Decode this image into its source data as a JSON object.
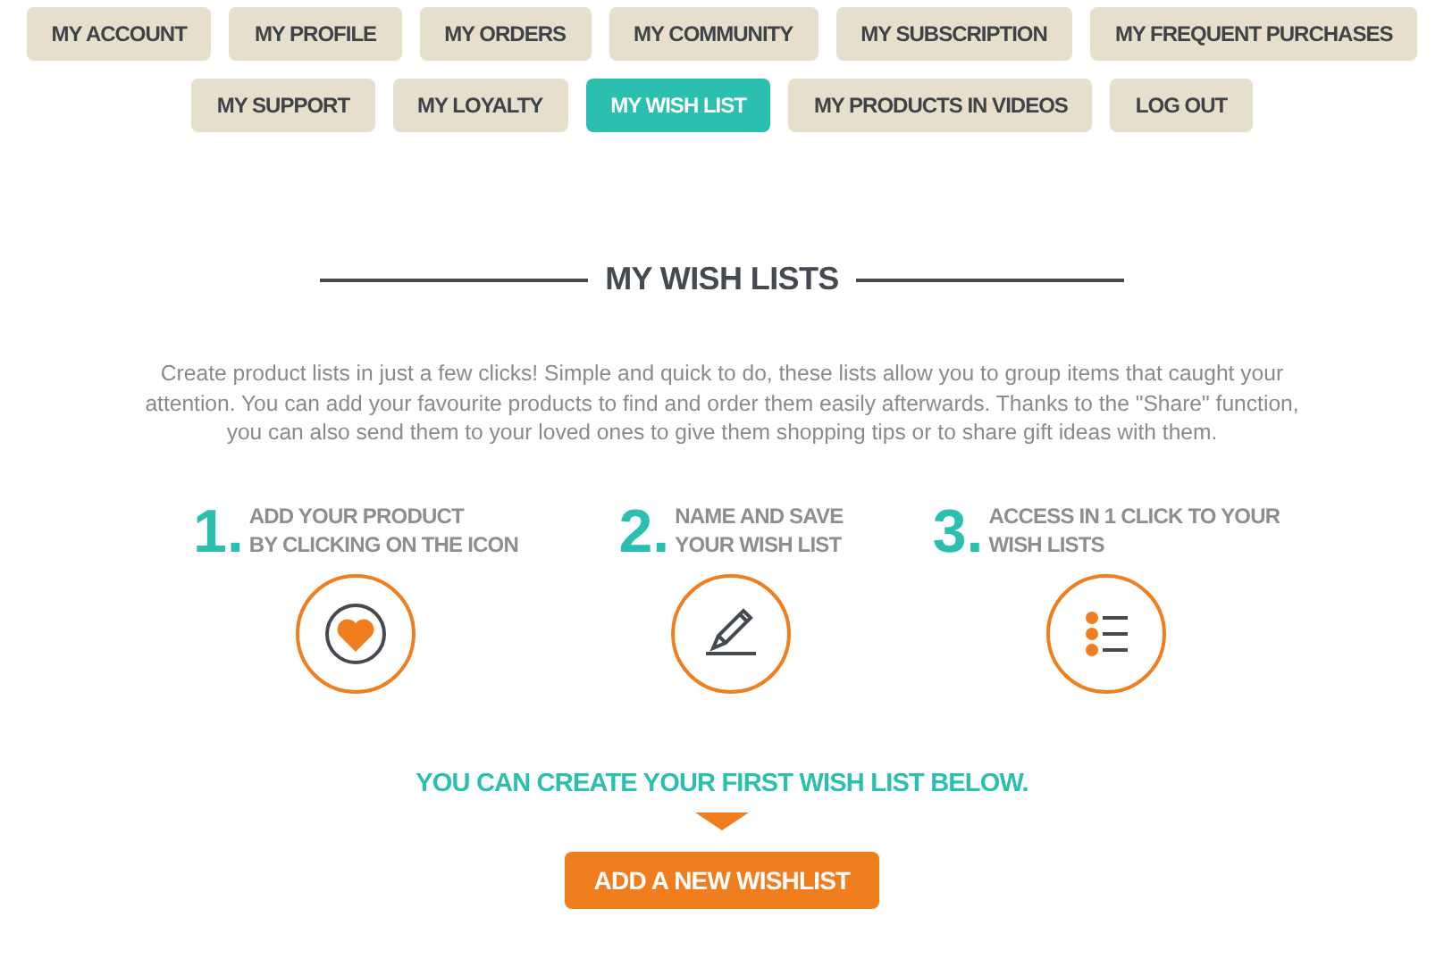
{
  "nav": [
    [
      {
        "label": "MY ACCOUNT",
        "selected": false
      },
      {
        "label": "MY PROFILE",
        "selected": false
      },
      {
        "label": "MY ORDERS",
        "selected": false
      },
      {
        "label": "MY COMMUNITY",
        "selected": false
      },
      {
        "label": "MY SUBSCRIPTION",
        "selected": false
      },
      {
        "label": "MY FREQUENT PURCHASES",
        "selected": false
      }
    ],
    [
      {
        "label": "MY SUPPORT",
        "selected": false
      },
      {
        "label": "MY LOYALTY",
        "selected": false
      },
      {
        "label": "MY WISH LIST",
        "selected": true
      },
      {
        "label": "MY PRODUCTS IN VIDEOS",
        "selected": false
      },
      {
        "label": "LOG OUT",
        "selected": false
      }
    ]
  ],
  "heading": "MY WISH LISTS",
  "intro": "Create product lists in just a few clicks! Simple and quick to do, these lists allow you to group items that caught your attention. You can add your favourite products to find and order them easily afterwards. Thanks to the \"Share\" function, you can also send them to your loved ones to give them shopping tips or to share gift ideas with them.",
  "steps": [
    {
      "number": "1.",
      "lines": [
        "ADD YOUR PRODUCT",
        "BY CLICKING ON THE ICON"
      ],
      "kind": "heart"
    },
    {
      "number": "2.",
      "lines": [
        "NAME AND SAVE",
        "YOUR WISH LIST"
      ],
      "kind": "pencil"
    },
    {
      "number": "3.",
      "lines": [
        "ACCESS IN 1 CLICK TO YOUR",
        "WISH LISTS"
      ],
      "kind": "list"
    }
  ],
  "cta_text": "YOU CAN CREATE YOUR FIRST WISH LIST BELOW.",
  "button": "ADD A NEW WISHLIST"
}
